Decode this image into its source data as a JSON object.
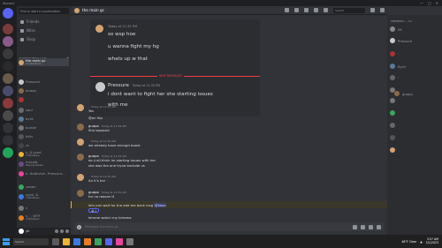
{
  "window": {
    "title": "discord",
    "controls": [
      "—",
      "□",
      "✕"
    ]
  },
  "channels_sidebar": {
    "search_placeholder": "Find or start a conversation",
    "nav": [
      {
        "label": "Friends",
        "icon": "friends-icon"
      },
      {
        "label": "Nitro",
        "icon": "nitro-icon"
      },
      {
        "label": "Shop",
        "icon": "shop-icon"
      }
    ],
    "dm_header": "DIRECT MESSAGES",
    "dms": [
      {
        "name": "the main gc",
        "sub": "12 Members",
        "color": "#d4a373",
        "active": true
      },
      {
        "name": "Pressure",
        "sub": "",
        "color": "#c9c9c9"
      },
      {
        "name": "guapo",
        "sub": "",
        "color": "#8b6a4a"
      },
      {
        "name": "ʿ",
        "sub": "",
        "color": "#a33"
      },
      {
        "name": "saul",
        "sub": "",
        "color": "#6a6a6a"
      },
      {
        "name": "byrd",
        "sub": "",
        "color": "#5a7a9a"
      },
      {
        "name": "burbie",
        "sub": "",
        "color": "#777"
      },
      {
        "name": "kitty",
        "sub": "",
        "color": "#555"
      },
      {
        "name": "rx",
        "sub": "",
        "color": "#444"
      },
      {
        "name": "s, & syed",
        "sub": "3 Members",
        "color": "#f0b232"
      },
      {
        "name": "mraxfa",
        "sub": "Playing Medal",
        "color": "#6a4a8a"
      },
      {
        "name": "jj, Hadiiytch, Pressure...",
        "sub": "",
        "color": "#eb459e"
      },
      {
        "name": "cgnan",
        "sub": "",
        "color": "#3ba55c"
      },
      {
        "name": "syed, &",
        "sub": "3 Members",
        "color": "#3b7be0"
      },
      {
        "name": "y",
        "sub": "",
        "color": "#777"
      },
      {
        "name": "n, ʿ, WTF",
        "sub": "4 Members",
        "color": "#e67e22"
      }
    ]
  },
  "user_panel": {
    "name": "yh",
    "status": ""
  },
  "channel_header": {
    "name": "the main gc",
    "search_placeholder": "Search"
  },
  "messages": {
    "forwarded": {
      "first": {
        "author": "",
        "time": "Today at 11:32 PM",
        "lines": [
          "so wsp hoe",
          "u wanna fight my hg",
          "whats up w that"
        ]
      },
      "divider": "NEW MESSAGES",
      "second": {
        "author": "Pressure",
        "time": "Today at 11:33 PM",
        "lines": [
          "i dont want to fight her she starting issues",
          "with me"
        ]
      }
    },
    "list": [
      {
        "author": "",
        "time": "Today at 11:34 AM",
        "lines": [
          "Yes"
        ],
        "color": "#d4a373"
      },
      {
        "author": "",
        "time": "",
        "lines": [
          "@on You"
        ],
        "color": ""
      },
      {
        "author": "guapo",
        "time": "Today at 11:34 AM",
        "lines": [
          "She boosted"
        ],
        "color": "#8b6a4a"
      },
      {
        "author": "",
        "time": "Today at 11:34 AM",
        "lines": [
          "we already have enough boost"
        ],
        "color": "#d4a373"
      },
      {
        "author": "guapo",
        "time": "Today at 11:34 AM",
        "lines": [
          "do y'all think im starting issues with her",
          "she was the one tryna exclude us"
        ],
        "color": "#8b6a4a"
      },
      {
        "author": "",
        "time": "Today at 11:35 AM",
        "lines": [
          "An K's her"
        ],
        "color": "#d4a373"
      },
      {
        "author": "guapo",
        "time": "Today at 11:35 AM",
        "lines": [
          "for no reason tf"
        ],
        "color": "#8b6a4a"
      }
    ],
    "highlight_line": {
      "text": "lets just wait for the add me back msg",
      "mention": "@keon"
    },
    "reaction": {
      "emoji": "😂",
      "count": "1"
    },
    "last_line": "lemme watch my kdrama"
  },
  "composer": {
    "placeholder": "Message the main gc"
  },
  "members": {
    "header": "MEMBERS — 12",
    "list": [
      {
        "name": "lilt",
        "color": "#888"
      },
      {
        "name": "Pressure",
        "color": "#c9c9c9"
      },
      {
        "name": "ʿ",
        "color": "#a33"
      },
      {
        "name": "Byrd",
        "color": "#5a7a9a"
      },
      {
        "name": "ʿ",
        "color": "#666"
      },
      {
        "name": "",
        "color": "#777"
      },
      {
        "name": "",
        "color": "#777"
      },
      {
        "name": "guapo",
        "color": "#8b6a4a"
      },
      {
        "name": "",
        "color": "#3ba55c"
      },
      {
        "name": "",
        "color": "#666"
      },
      {
        "name": "",
        "color": "#555"
      },
      {
        "name": "",
        "color": "#d4a373"
      }
    ]
  },
  "taskbar": {
    "search_placeholder": "Search",
    "weather": "48°F Clear",
    "time": "3:57 AM",
    "date": "5/1/2023"
  }
}
